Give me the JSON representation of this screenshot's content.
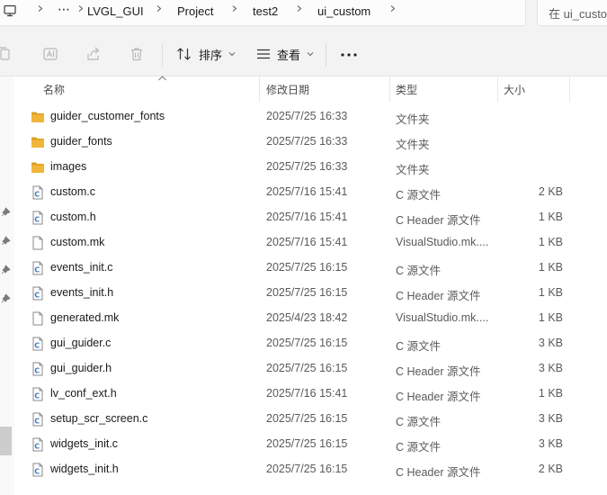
{
  "breadcrumb": {
    "more": "⋯",
    "items": [
      "LVGL_GUI",
      "Project",
      "test2",
      "ui_custom"
    ]
  },
  "search": {
    "text": "在 ui_custom"
  },
  "toolbar": {
    "sort_label": "排序",
    "view_label": "查看",
    "more_label": "···"
  },
  "columns": {
    "name": "名称",
    "date": "修改日期",
    "type": "类型",
    "size": "大小"
  },
  "files": [
    {
      "icon": "folder-icon",
      "name": "guider_customer_fonts",
      "date": "2025/7/25 16:33",
      "type": "文件夹",
      "size": ""
    },
    {
      "icon": "folder-icon",
      "name": "guider_fonts",
      "date": "2025/7/25 16:33",
      "type": "文件夹",
      "size": ""
    },
    {
      "icon": "folder-icon",
      "name": "images",
      "date": "2025/7/25 16:33",
      "type": "文件夹",
      "size": ""
    },
    {
      "icon": "c-source-icon",
      "name": "custom.c",
      "date": "2025/7/16 15:41",
      "type": "C 源文件",
      "size": "2 KB"
    },
    {
      "icon": "c-header-icon",
      "name": "custom.h",
      "date": "2025/7/16 15:41",
      "type": "C Header 源文件",
      "size": "1 KB"
    },
    {
      "icon": "file-icon",
      "name": "custom.mk",
      "date": "2025/7/16 15:41",
      "type": "VisualStudio.mk....",
      "size": "1 KB"
    },
    {
      "icon": "c-source-icon",
      "name": "events_init.c",
      "date": "2025/7/25 16:15",
      "type": "C 源文件",
      "size": "1 KB"
    },
    {
      "icon": "c-header-icon",
      "name": "events_init.h",
      "date": "2025/7/25 16:15",
      "type": "C Header 源文件",
      "size": "1 KB"
    },
    {
      "icon": "file-icon",
      "name": "generated.mk",
      "date": "2025/4/23 18:42",
      "type": "VisualStudio.mk....",
      "size": "1 KB"
    },
    {
      "icon": "c-source-icon",
      "name": "gui_guider.c",
      "date": "2025/7/25 16:15",
      "type": "C 源文件",
      "size": "3 KB"
    },
    {
      "icon": "c-header-icon",
      "name": "gui_guider.h",
      "date": "2025/7/25 16:15",
      "type": "C Header 源文件",
      "size": "3 KB"
    },
    {
      "icon": "c-header-icon",
      "name": "lv_conf_ext.h",
      "date": "2025/7/16 15:41",
      "type": "C Header 源文件",
      "size": "1 KB"
    },
    {
      "icon": "c-source-icon",
      "name": "setup_scr_screen.c",
      "date": "2025/7/25 16:15",
      "type": "C 源文件",
      "size": "3 KB"
    },
    {
      "icon": "c-source-icon",
      "name": "widgets_init.c",
      "date": "2025/7/25 16:15",
      "type": "C 源文件",
      "size": "3 KB"
    },
    {
      "icon": "c-header-icon",
      "name": "widgets_init.h",
      "date": "2025/7/25 16:15",
      "type": "C Header 源文件",
      "size": "2 KB"
    }
  ],
  "colors": {
    "folder": "#f0b63a",
    "folder_dark": "#dba023",
    "c_file_accent": "#3a78c4"
  }
}
